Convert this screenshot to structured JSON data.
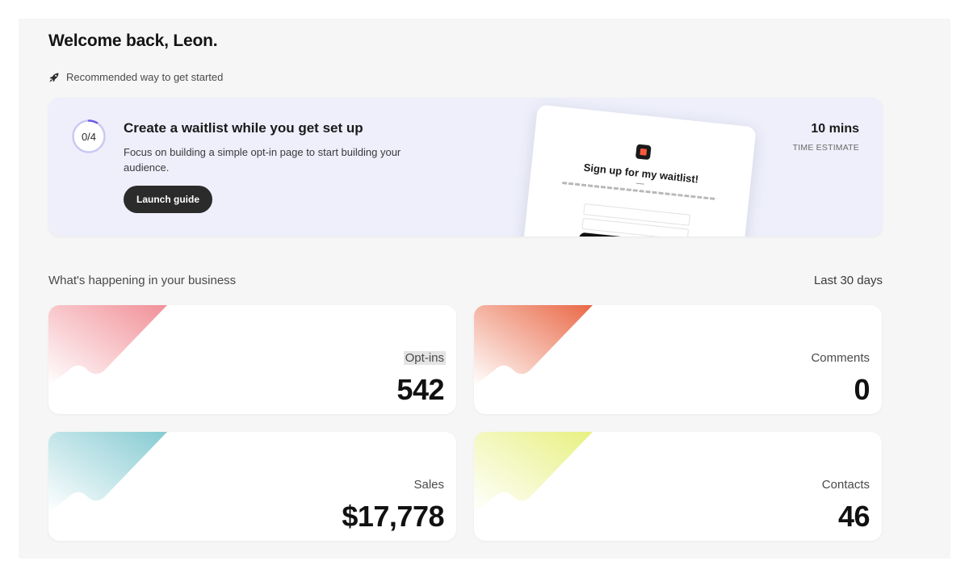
{
  "header": {
    "greeting": "Welcome back, Leon.",
    "recommend_text": "Recommended way to get started",
    "recommend_icon": "rocket-icon"
  },
  "guide": {
    "progress_label": "0/4",
    "progress_fraction": 0.0,
    "title": "Create a waitlist while you get set up",
    "description": "Focus on building a simple opt-in page to start building your audience.",
    "button_label": "Launch guide",
    "time_value": "10 mins",
    "time_label": "TIME ESTIMATE",
    "preview": {
      "title": "Sign up for my waitlist!"
    }
  },
  "business": {
    "section_title": "What's happening in your business",
    "range_label": "Last 30 days",
    "stats": [
      {
        "label": "Opt-ins",
        "value": "542",
        "color": "#f08a92"
      },
      {
        "label": "Comments",
        "value": "0",
        "color": "#e8603c"
      },
      {
        "label": "Sales",
        "value": "$17,778",
        "color": "#7fc8d0"
      },
      {
        "label": "Contacts",
        "value": "46",
        "color": "#e6f07a"
      }
    ]
  }
}
